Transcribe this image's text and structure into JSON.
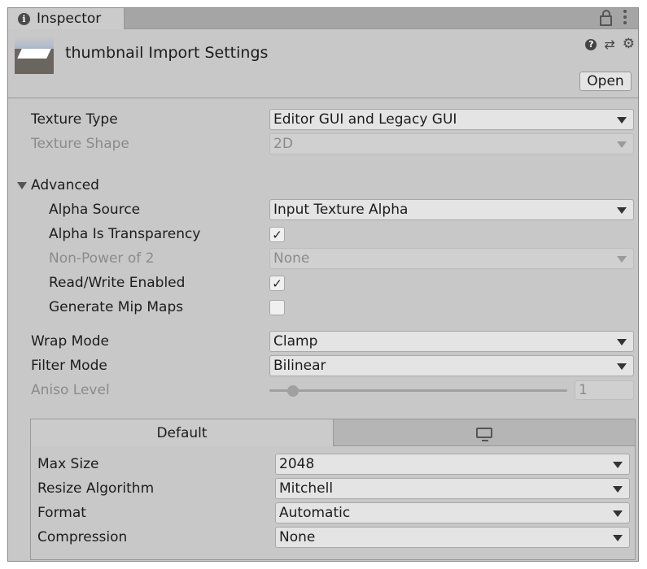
{
  "window": {
    "tab_title": "Inspector",
    "tab_icon": "info-icon",
    "toolbar_icons": [
      "lock-icon",
      "kebab-menu-icon"
    ]
  },
  "header": {
    "title": "thumbnail Import Settings",
    "icons": [
      "help-icon",
      "preset-sliders-icon",
      "gear-icon"
    ],
    "open_button": "Open"
  },
  "texture": {
    "type_label": "Texture Type",
    "type_value": "Editor GUI and Legacy GUI",
    "shape_label": "Texture Shape",
    "shape_value": "2D"
  },
  "advanced": {
    "label": "Advanced",
    "expanded": true,
    "alpha_source_label": "Alpha Source",
    "alpha_source_value": "Input Texture Alpha",
    "alpha_transparency_label": "Alpha Is Transparency",
    "alpha_transparency_checked": true,
    "npot_label": "Non-Power of 2",
    "npot_value": "None",
    "read_write_label": "Read/Write Enabled",
    "read_write_checked": true,
    "mipmaps_label": "Generate Mip Maps",
    "mipmaps_checked": false,
    "check_glyph": "✓"
  },
  "sampling": {
    "wrap_label": "Wrap Mode",
    "wrap_value": "Clamp",
    "filter_label": "Filter Mode",
    "filter_value": "Bilinear",
    "aniso_label": "Aniso Level",
    "aniso_value": "1",
    "aniso_fraction": 0.0
  },
  "platform": {
    "tabs": [
      {
        "label": "Default",
        "active": true
      },
      {
        "label": "",
        "icon": "monitor-icon",
        "active": false
      }
    ],
    "max_size_label": "Max Size",
    "max_size_value": "2048",
    "resize_label": "Resize Algorithm",
    "resize_value": "Mitchell",
    "format_label": "Format",
    "format_value": "Automatic",
    "compression_label": "Compression",
    "compression_value": "None"
  }
}
